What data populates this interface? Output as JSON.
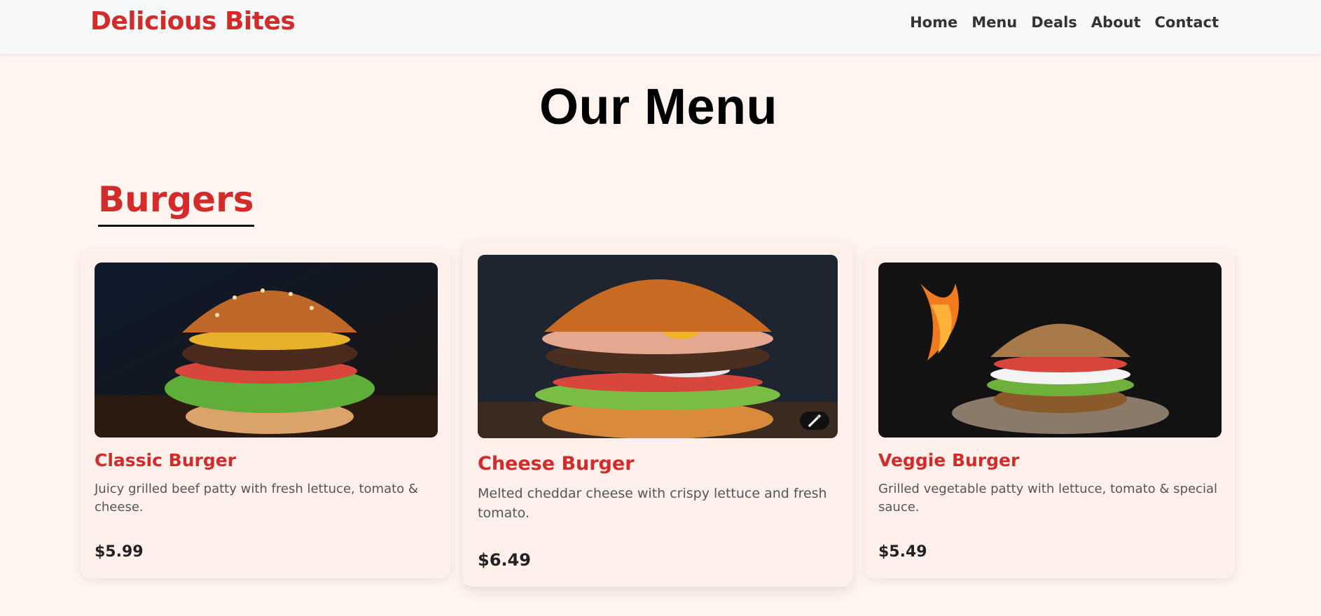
{
  "brand": "Delicious Bites",
  "nav": {
    "items": [
      {
        "label": "Home"
      },
      {
        "label": "Menu"
      },
      {
        "label": "Deals"
      },
      {
        "label": "About"
      },
      {
        "label": "Contact"
      }
    ]
  },
  "page_title": "Our Menu",
  "section": {
    "title": "Burgers",
    "items": [
      {
        "name": "Classic Burger",
        "description": "Juicy grilled beef patty with fresh lettuce, tomato & cheese.",
        "price": "$5.99",
        "image_icon": "burger-photo"
      },
      {
        "name": "Cheese Burger",
        "description": "Melted cheddar cheese with crispy lettuce and fresh tomato.",
        "price": "$6.49",
        "image_icon": "burger-photo"
      },
      {
        "name": "Veggie Burger",
        "description": "Grilled vegetable patty with lettuce, tomato & special sauce.",
        "price": "$5.49",
        "image_icon": "burger-photo"
      }
    ]
  },
  "colors": {
    "brand_red": "#d32a2a",
    "page_bg": "#fff4ef",
    "card_bg": "#fff0ec",
    "nav_bg": "#f7f8fa"
  }
}
